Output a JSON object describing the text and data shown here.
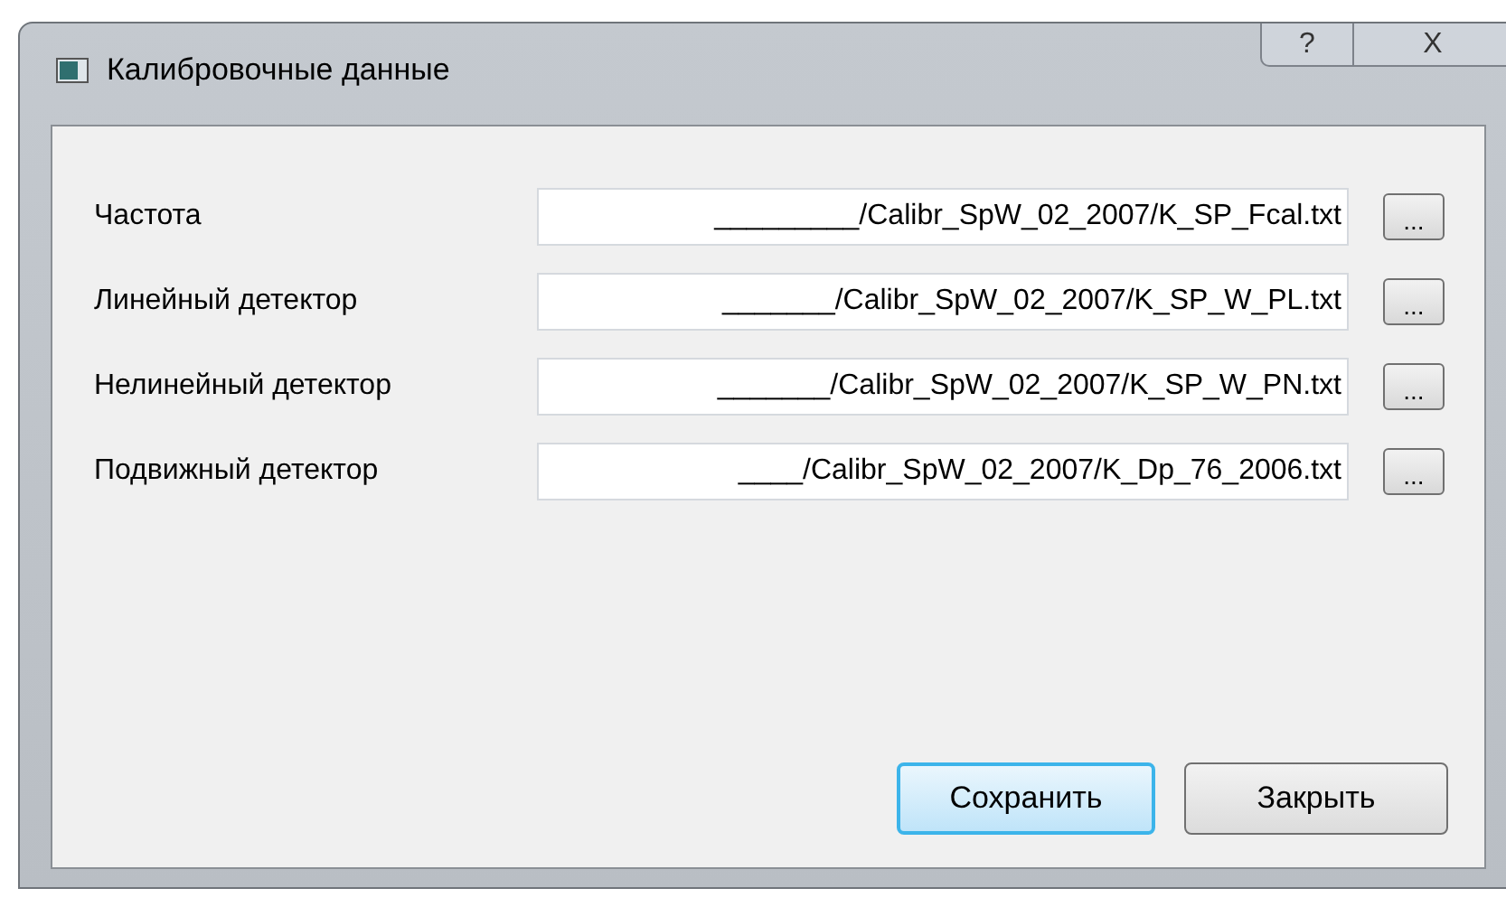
{
  "window": {
    "title": "Калибровочные данные",
    "help_button": "?",
    "close_button": "X"
  },
  "rows": [
    {
      "label": "Частота",
      "value": "_________/Calibr_SpW_02_2007/K_SP_Fcal.txt",
      "browse": "..."
    },
    {
      "label": "Линейный детектор",
      "value": "_______/Calibr_SpW_02_2007/K_SP_W_PL.txt",
      "browse": "..."
    },
    {
      "label": "Нелинейный детектор",
      "value": "_______/Calibr_SpW_02_2007/K_SP_W_PN.txt",
      "browse": "..."
    },
    {
      "label": "Подвижный детектор",
      "value": "____/Calibr_SpW_02_2007/K_Dp_76_2006.txt",
      "browse": "..."
    }
  ],
  "buttons": [
    {
      "label": "Сохранить",
      "default": true
    },
    {
      "label": "Закрыть",
      "default": false
    }
  ]
}
